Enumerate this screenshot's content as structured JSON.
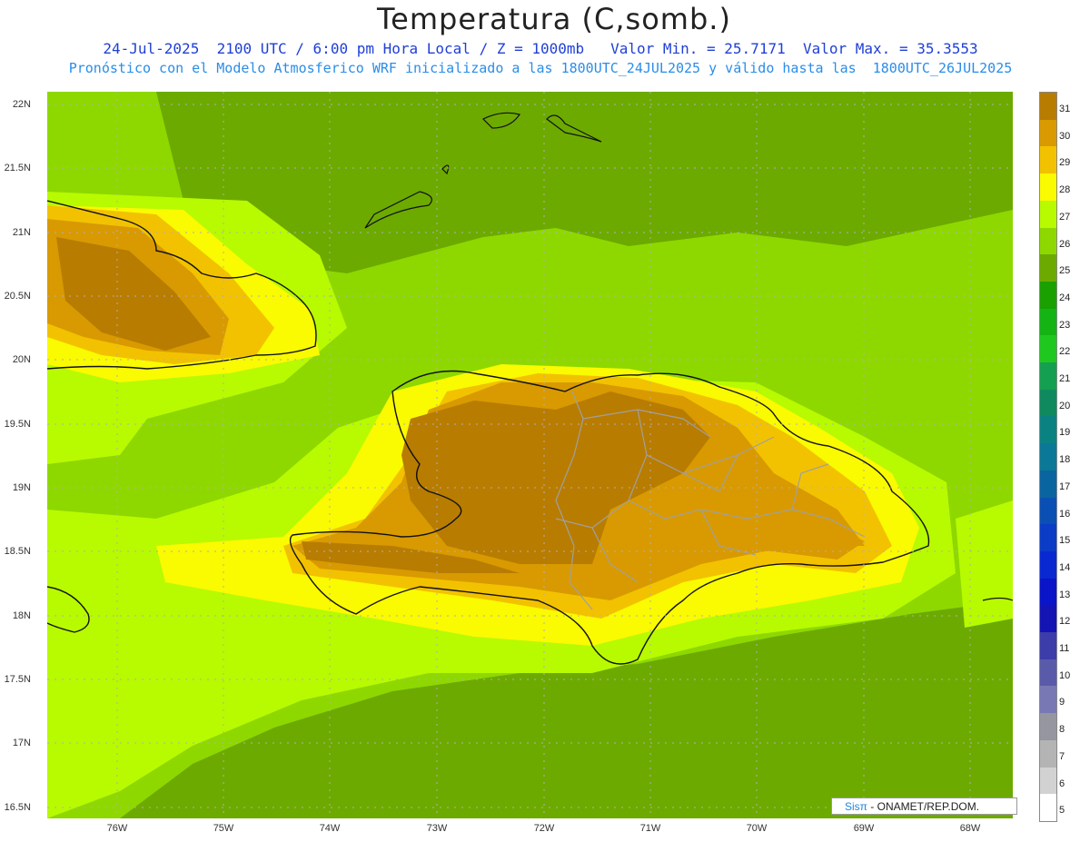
{
  "header": {
    "title": "Temperatura (C,somb.)",
    "subtitle_1": "24-Jul-2025  2100 UTC / 6:00 pm Hora Local / Z = 1000mb   Valor Min. = 25.7171  Valor Max. = 35.3553",
    "subtitle_2": "Pronóstico con el Modelo Atmosferico WRF inicializado a las 1800UTC_24JUL2025 y válido hasta las  1800UTC_26JUL2025"
  },
  "axes": {
    "lat_labels": [
      "22N",
      "21.5N",
      "21N",
      "20.5N",
      "20N",
      "19.5N",
      "19N",
      "18.5N",
      "18N",
      "17.5N",
      "17N",
      "16.5N"
    ],
    "lon_labels": [
      "76W",
      "75W",
      "74W",
      "73W",
      "72W",
      "71W",
      "70W",
      "69W",
      "68W"
    ]
  },
  "colorbar": {
    "labels": [
      "31",
      "30",
      "29",
      "28",
      "27",
      "26",
      "25",
      "24",
      "23",
      "22",
      "21",
      "20",
      "19",
      "18",
      "17",
      "16",
      "15",
      "14",
      "13",
      "12",
      "11",
      "10",
      "9",
      "8",
      "7",
      "6",
      "5"
    ],
    "colors": [
      "#b87c00",
      "#d89a00",
      "#f2c200",
      "#fafa00",
      "#b8fa00",
      "#8ed800",
      "#6caa00",
      "#1aa000",
      "#14b414",
      "#1ec81e",
      "#14a050",
      "#0f8a5f",
      "#0a8282",
      "#0a7896",
      "#0a64a0",
      "#0a50b4",
      "#0a3cc8",
      "#0a28d2",
      "#0a14c8",
      "#1414b4",
      "#3c3caa",
      "#5a5aaa",
      "#7878b4",
      "#9696a0",
      "#b4b4b4",
      "#d2d2d2",
      "#ffffff"
    ]
  },
  "fill_colors": {
    "sea_dark": "#6caa00",
    "sea": "#8ed800",
    "warm_sea": "#b8fa00",
    "yellow": "#fafa00",
    "gold": "#f2c200",
    "orange": "#d89a00",
    "brown": "#b87c00",
    "border": "#111111",
    "province_border": "#a0a0a0"
  },
  "credit": {
    "brand": "Sisπ",
    "text": " - ONAMET/REP.DOM."
  }
}
